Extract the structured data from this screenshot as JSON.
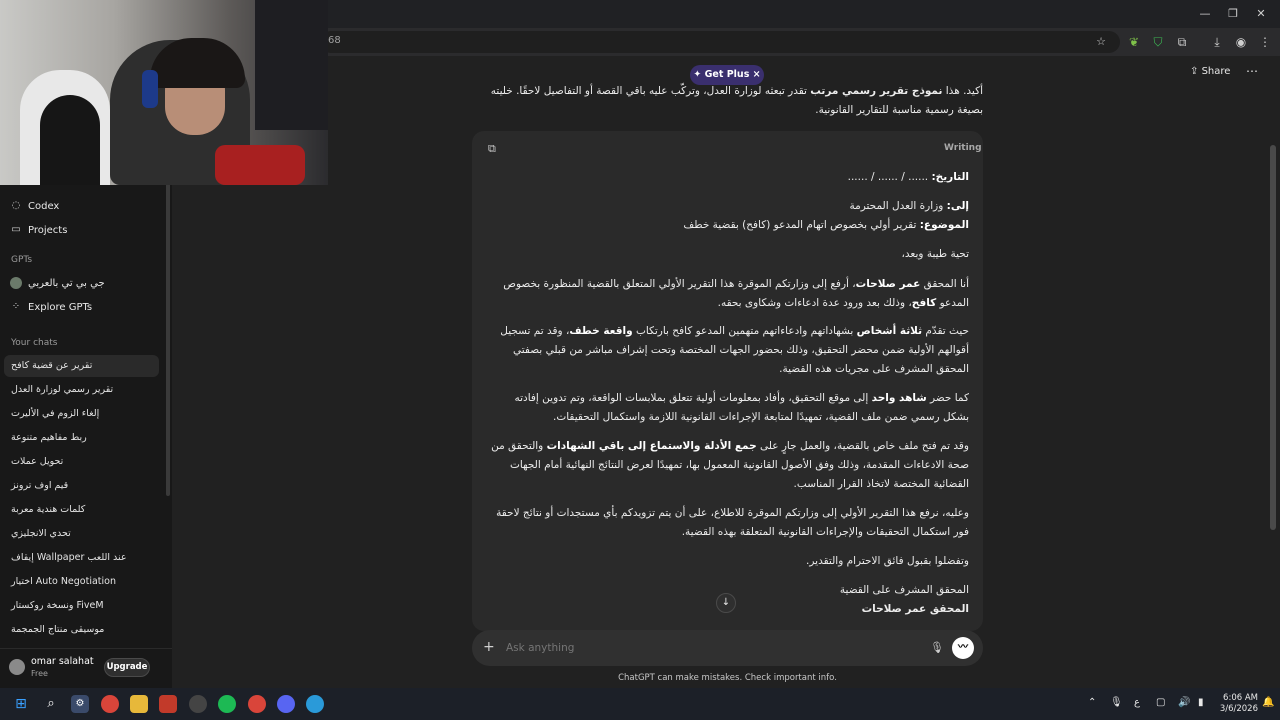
{
  "browser": {
    "address": "68",
    "window_controls": [
      "—",
      "❐",
      "✕"
    ]
  },
  "sidebar": {
    "nav": [
      {
        "label": "Codex",
        "icon": "codex-icon"
      },
      {
        "label": "Projects",
        "icon": "folder-icon"
      }
    ],
    "gpts_label": "GPTs",
    "gpts": [
      {
        "label": "جي بي تي بالعربي"
      },
      {
        "label": "Explore GPTs"
      }
    ],
    "chats_label": "Your chats",
    "chats": [
      "تقرير عن قضية كافح",
      "تقرير رسمي لوزارة العدل",
      "إلغاء الزوم في الأليرت",
      "ربط مفاهيم متنوعة",
      "تحويل عملات",
      "قيم اوف ترونز",
      "كلمات هندية معربة",
      "تحدي الانجليزي",
      "إيقاف Wallpaper عند اللعب",
      "اختيار Auto Negotiation",
      "ونسخة روكستار FiveM",
      "موسيقى منتاج الجمجمة"
    ],
    "user": {
      "name": "omar salahat",
      "plan": "Free",
      "upgrade_label": "Upgrade"
    }
  },
  "header": {
    "getplus_label": "✦ Get Plus  ×",
    "share_label": "Share"
  },
  "conversation": {
    "intro_prefix": "أكيد. هذا ",
    "intro_bold": "نموذج تقرير رسمي مرتب",
    "intro_rest": " تقدر تبعثه لوزارة العدل، وتركّب عليه باقي القصة أو التفاصيل لاحقًا. خليته بصيغة رسمية مناسبة للتقارير القانونية.",
    "writing_label": "Writing",
    "doc": {
      "date_label": "التاريخ:",
      "date_value": " ...... / ...... / ......",
      "to_label": "إلى:",
      "to_value": " وزارة العدل المحترمة",
      "subject_label": "الموضوع:",
      "subject_value": " تقرير أولي بخصوص اتهام المدعو (كافح) بقضية خطف",
      "greeting": "تحية طيبة وبعد،",
      "p1_a": "أنا المحقق ",
      "p1_b": "عمر صلاحات",
      "p1_c": "، أرفع إلى وزارتكم الموقرة هذا التقرير الأولي المتعلق بالقضية المنظورة بخصوص المدعو ",
      "p1_d": "كافح",
      "p1_e": "، وذلك بعد ورود عدة ادعاءات وشكاوى بحقه.",
      "p2_a": "حيث تقدّم ",
      "p2_b": "ثلاثة أشخاص",
      "p2_c": " بشهاداتهم وادعاءاتهم متهمين المدعو كافح بارتكاب ",
      "p2_d": "واقعة خطف",
      "p2_e": "، وقد تم تسجيل أقوالهم الأولية ضمن محضر التحقيق، وذلك بحضور الجهات المختصة وتحت إشراف مباشر من قبلي بصفتي المحقق المشرف على مجريات هذه القضية.",
      "p3_a": "كما حضر ",
      "p3_b": "شاهد واحد",
      "p3_c": " إلى موقع التحقيق، وأفاد بمعلومات أولية تتعلق بملابسات الواقعة، وتم تدوين إفادته بشكل رسمي ضمن ملف القضية، تمهيدًا لمتابعة الإجراءات القانونية اللازمة واستكمال التحقيقات.",
      "p4_a": "وقد تم فتح ملف خاص بالقضية، والعمل جارٍ على ",
      "p4_b": "جمع الأدلة والاستماع إلى باقي الشهادات",
      "p4_c": " والتحقق من صحة الادعاءات المقدمة، وذلك وفق الأصول القانونية المعمول بها، تمهيدًا لعرض النتائج النهائية أمام الجهات القضائية المختصة لاتخاذ القرار المناسب.",
      "p5": "وعليه، نرفع هذا التقرير الأولي إلى وزارتكم الموقرة للاطلاع، على أن يتم تزويدكم بأي مستجدات أو نتائج لاحقة فور استكمال التحقيقات والإجراءات القانونية المتعلقة بهذه القضية.",
      "p6": "وتفضلوا بقبول فائق الاحترام والتقدير.",
      "sign_title": "المحقق المشرف على القضية",
      "sign_name": "المحقق عمر صلاحات"
    }
  },
  "composer": {
    "placeholder": "Ask anything",
    "disclaimer": "ChatGPT can make mistakes. Check important info."
  },
  "taskbar": {
    "clock_time": "6:06 AM",
    "clock_date": "3/6/2026",
    "lang": "ع"
  },
  "colors": {
    "background": "#212121",
    "sidebar": "#181818",
    "accent_getplus": "#3a2f6e"
  }
}
